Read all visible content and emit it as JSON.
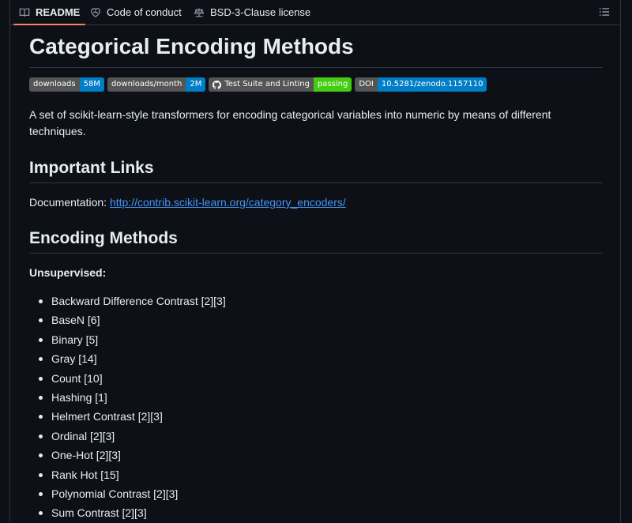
{
  "tabs": [
    {
      "label": "README",
      "icon": "book-icon",
      "active": true
    },
    {
      "label": "Code of conduct",
      "icon": "heart-icon",
      "active": false
    },
    {
      "label": "BSD-3-Clause license",
      "icon": "law-icon",
      "active": false
    }
  ],
  "outline_icon": "list-icon",
  "title": "Categorical Encoding Methods",
  "badges": [
    {
      "key": "downloads",
      "value": "58M",
      "color": "#007ec6"
    },
    {
      "key": "downloads/month",
      "value": "2M",
      "color": "#007ec6"
    },
    {
      "key": "Test Suite and Linting",
      "value": "passing",
      "color": "#4c1",
      "icon": "github-icon"
    },
    {
      "key": "DOI",
      "value": "10.5281/zenodo.1157110",
      "color": "#007ec6"
    }
  ],
  "description": "A set of scikit-learn-style transformers for encoding categorical variables into numeric by means of different techniques.",
  "important_links": {
    "heading": "Important Links",
    "doc_label": "Documentation: ",
    "doc_url": "http://contrib.scikit-learn.org/category_encoders/"
  },
  "encoding_methods": {
    "heading": "Encoding Methods",
    "unsupervised_label": "Unsupervised:",
    "items": [
      "Backward Difference Contrast [2][3]",
      "BaseN [6]",
      "Binary [5]",
      "Gray [14]",
      "Count [10]",
      "Hashing [1]",
      "Helmert Contrast [2][3]",
      "Ordinal [2][3]",
      "One-Hot [2][3]",
      "Rank Hot [15]",
      "Polynomial Contrast [2][3]",
      "Sum Contrast [2][3]"
    ]
  },
  "colors": {
    "background": "#0d1117",
    "text": "#e6edf3",
    "link": "#4493f8",
    "active_tab_underline": "#f78166",
    "border": "#30363d"
  }
}
